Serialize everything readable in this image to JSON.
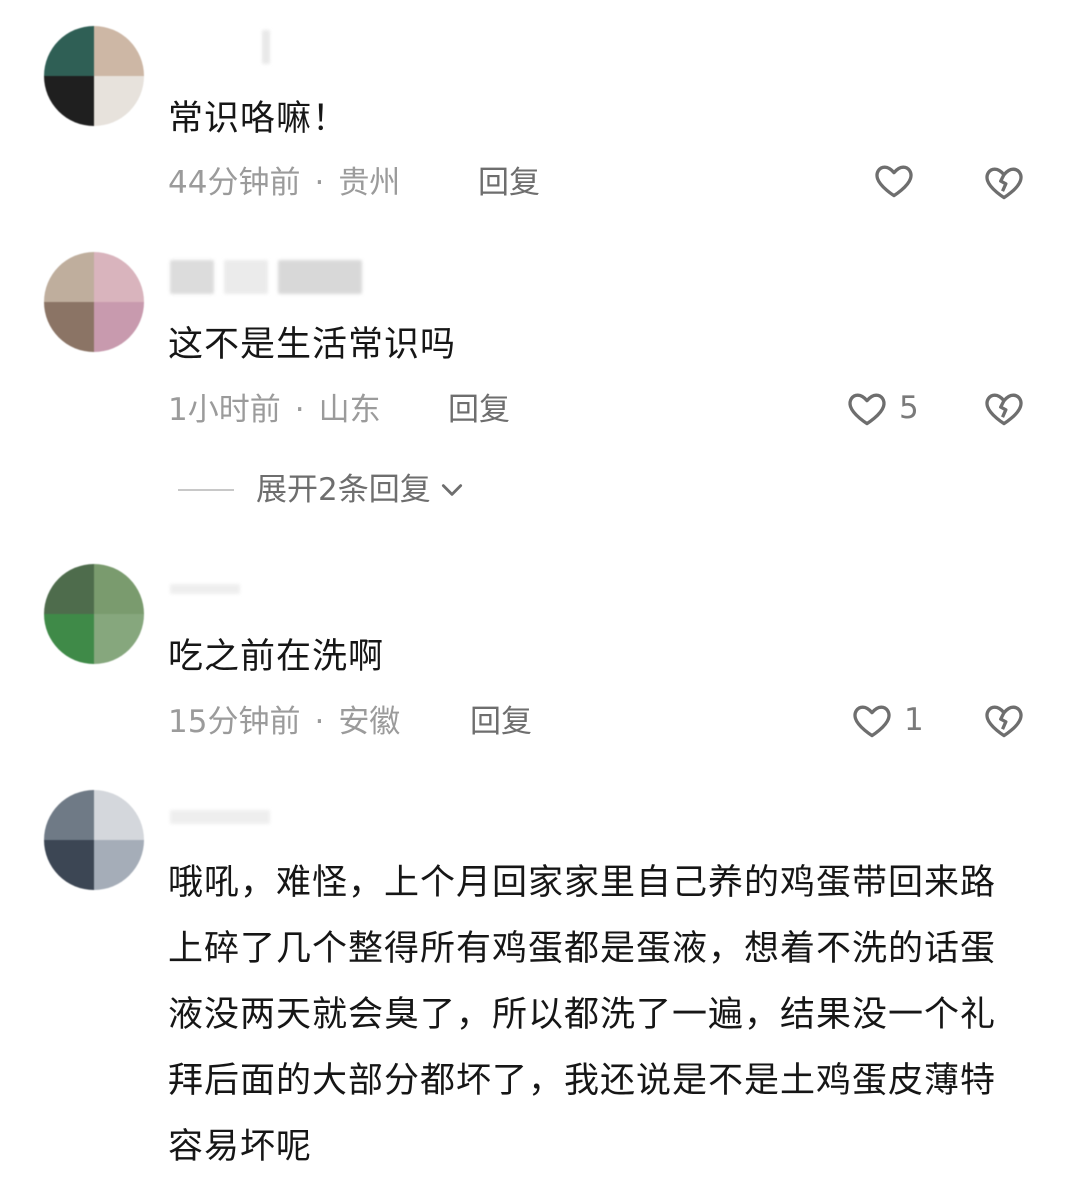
{
  "comments": [
    {
      "text": "常识咯嘛！",
      "time": "44分钟前",
      "separator": "·",
      "location": "贵州",
      "reply_label": "回复",
      "likes": "",
      "avatar_colors": [
        "#2f5f55",
        "#cdb7a5",
        "#1f1f1f",
        "#e7e2dc"
      ]
    },
    {
      "text": "这不是生活常识吗",
      "time": "1小时前",
      "separator": "·",
      "location": "山东",
      "reply_label": "回复",
      "likes": "5",
      "expand_label": "展开2条回复",
      "avatar_colors": [
        "#bfae9d",
        "#d9b4bd",
        "#8b7465",
        "#c89aae"
      ]
    },
    {
      "text": "吃之前在洗啊",
      "time": "15分钟前",
      "separator": "·",
      "location": "安徽",
      "reply_label": "回复",
      "likes": "1",
      "avatar_colors": [
        "#4e6c4c",
        "#7a9b6e",
        "#3f8a48",
        "#86a77d"
      ]
    },
    {
      "text": "哦吼，难怪，上个月回家家里自己养的鸡蛋带回来路上碎了几个整得所有鸡蛋都是蛋液，想着不洗的话蛋液没两天就会臭了，所以都洗了一遍，结果没一个礼拜后面的大部分都坏了，我还说是不是土鸡蛋皮薄特容易坏呢",
      "avatar_colors": [
        "#6f7a86",
        "#d4d7dc",
        "#3c4654",
        "#a5adb8"
      ]
    }
  ],
  "icons": {
    "like": "heart-outline-icon",
    "dislike": "broken-heart-icon",
    "expand": "chevron-down-icon"
  },
  "colors": {
    "text": "#161616",
    "meta": "#9b9b9b",
    "icon": "#6e6e6e"
  }
}
